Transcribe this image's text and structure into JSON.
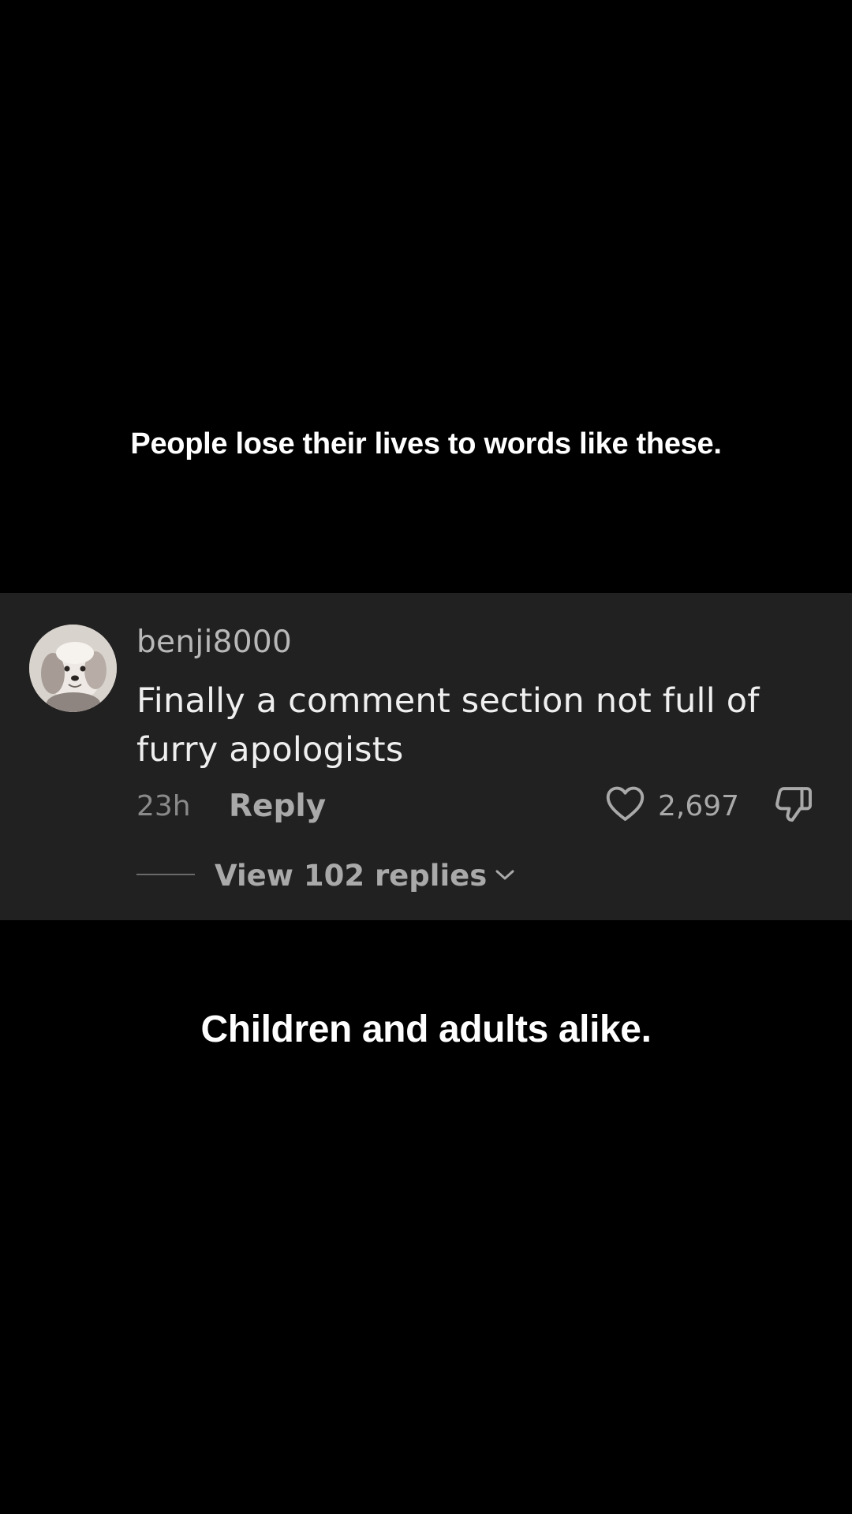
{
  "captions": {
    "top": "People lose their lives to words like these.",
    "bottom": "Children and adults alike."
  },
  "comment": {
    "username": "benji8000",
    "text": "Finally a comment section not full of furry apologists",
    "timestamp": "23h",
    "reply_label": "Reply",
    "like_count": "2,697",
    "view_replies_label": "View 102 replies",
    "icons": {
      "avatar": "dog-avatar",
      "like": "heart-outline-icon",
      "dislike": "thumbs-down-icon",
      "expand": "chevron-down-icon"
    }
  },
  "colors": {
    "background": "#000000",
    "card": "#212121",
    "primary_text": "#efefef",
    "secondary_text": "#a9a9a9",
    "caption_text": "#ffffff"
  }
}
